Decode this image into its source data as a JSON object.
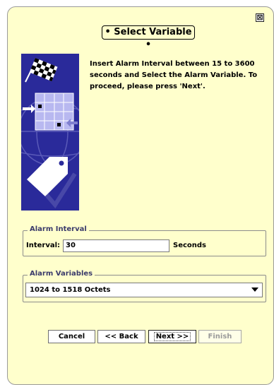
{
  "dialog": {
    "close_label": "⊠",
    "title": "• Select Variable •",
    "instructions": "Insert Alarm Interval between 15 to 3600 seconds and Select the Alarm Variable. To proceed, please press 'Next'."
  },
  "alarm_interval": {
    "legend": "Alarm Interval",
    "label": "Interval:",
    "value": "30",
    "unit": "Seconds"
  },
  "alarm_variables": {
    "legend": "Alarm Variables",
    "selected": "1024 to 1518 Octets"
  },
  "buttons": {
    "cancel": "Cancel",
    "back": "<< Back",
    "next": "Next >>",
    "finish": "Finish"
  },
  "colors": {
    "panel_bg": "#ffffcc",
    "illustration_bg": "#2a2a9a",
    "legend_text": "#3b3b6b",
    "disabled_text": "#9a9a9a"
  }
}
